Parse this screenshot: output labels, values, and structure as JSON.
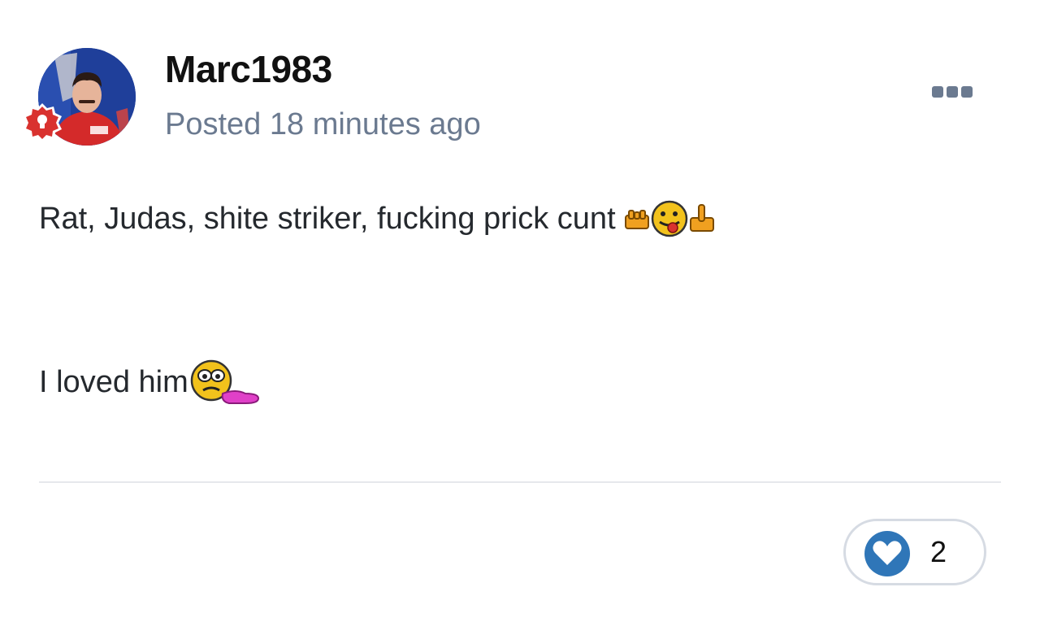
{
  "post": {
    "author": "Marc1983",
    "posted": "Posted 18 minutes ago",
    "body": {
      "line1_text": "Rat, Judas, shite striker, fucking prick cunt",
      "line1_emojis": [
        "fist-icon",
        "tongue-out-smiley-icon",
        "middle-finger-icon"
      ],
      "line2_text": "I loved him",
      "line2_emojis": [
        "crying-tissue-smiley-icon"
      ]
    }
  },
  "avatar": {
    "badge_icon": "lightbulb-icon",
    "badge_color": "#d9322f"
  },
  "more_menu": {
    "icon": "ellipsis-icon",
    "color": "#6b7a90"
  },
  "reactions": {
    "icon": "heart-icon",
    "count": "2",
    "color": "#2f76b8"
  }
}
